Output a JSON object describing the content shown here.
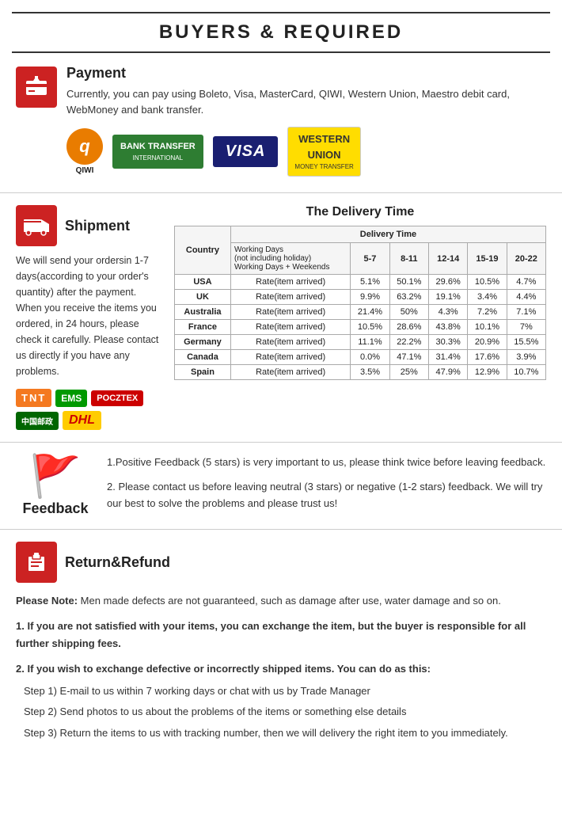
{
  "header": {
    "title": "BUYERS & REQUIRED"
  },
  "payment": {
    "section_title": "Payment",
    "description": "Currently, you can pay using Boleto, Visa, MasterCard, QIWI, Western Union, Maestro  debit card, WebMoney and bank transfer.",
    "logos": [
      {
        "name": "QIWI",
        "type": "qiwi"
      },
      {
        "name": "BANK TRANSFER INTERNATIONAL",
        "type": "bank_transfer"
      },
      {
        "name": "VISA",
        "type": "visa"
      },
      {
        "name": "WESTERN UNION MONEY TRANSFER",
        "type": "western_union"
      }
    ]
  },
  "shipment": {
    "section_title": "Shipment",
    "delivery_title": "The Delivery Time",
    "text": "We will send your ordersin 1-7 days(according to your order's quantity) after the payment. When you receive the items you ordered, in 24  hours, please check it carefully. Please  contact us directly if you have any problems.",
    "table": {
      "headers": [
        "Country",
        "Delivery Time"
      ],
      "sub_headers": [
        "Working Days\n(not including holiday)\nWorking Days + Weekends",
        "5-7",
        "8-11",
        "12-14",
        "15-19",
        "20-22"
      ],
      "rows": [
        {
          "country": "USA",
          "label": "Rate(item arrived)",
          "d1": "5.1%",
          "d2": "50.1%",
          "d3": "29.6%",
          "d4": "10.5%",
          "d5": "4.7%"
        },
        {
          "country": "UK",
          "label": "Rate(item arrived)",
          "d1": "9.9%",
          "d2": "63.2%",
          "d3": "19.1%",
          "d4": "3.4%",
          "d5": "4.4%"
        },
        {
          "country": "Australia",
          "label": "Rate(item arrived)",
          "d1": "21.4%",
          "d2": "50%",
          "d3": "4.3%",
          "d4": "7.2%",
          "d5": "7.1%"
        },
        {
          "country": "France",
          "label": "Rate(item arrived)",
          "d1": "10.5%",
          "d2": "28.6%",
          "d3": "43.8%",
          "d4": "10.1%",
          "d5": "7%"
        },
        {
          "country": "Germany",
          "label": "Rate(item arrived)",
          "d1": "11.1%",
          "d2": "22.2%",
          "d3": "30.3%",
          "d4": "20.9%",
          "d5": "15.5%"
        },
        {
          "country": "Canada",
          "label": "Rate(item arrived)",
          "d1": "0.0%",
          "d2": "47.1%",
          "d3": "31.4%",
          "d4": "17.6%",
          "d5": "3.9%"
        },
        {
          "country": "Spain",
          "label": "Rate(item arrived)",
          "d1": "3.5%",
          "d2": "25%",
          "d3": "47.9%",
          "d4": "12.9%",
          "d5": "10.7%"
        }
      ]
    }
  },
  "feedback": {
    "section_title": "Feedback",
    "point1": "1.Positive Feedback (5 stars) is very important to us, please think twice before leaving feedback.",
    "point2": "2. Please contact us before leaving neutral (3 stars) or negative  (1-2 stars) feedback. We will try our best to solve the problems and please trust us!"
  },
  "return_refund": {
    "section_title": "Return&Refund",
    "note_label": "Please Note:",
    "note_text": " Men made defects are not guaranteed, such as damage after use, water damage and so on.",
    "point1_label": "1. If you are not satisfied with your items, you can exchange the item, but the buyer is responsible for all further shipping fees.",
    "point2_label": "2. If you wish to exchange defective or incorrectly shipped items. You can do as this:",
    "steps": [
      "Step 1) E-mail to us within 7 working days or chat with us by Trade Manager",
      "Step 2) Send photos to us about the problems of the items or something else details",
      "Step 3) Return the items to us with tracking number, then we will delivery the right item to you immediately."
    ]
  }
}
